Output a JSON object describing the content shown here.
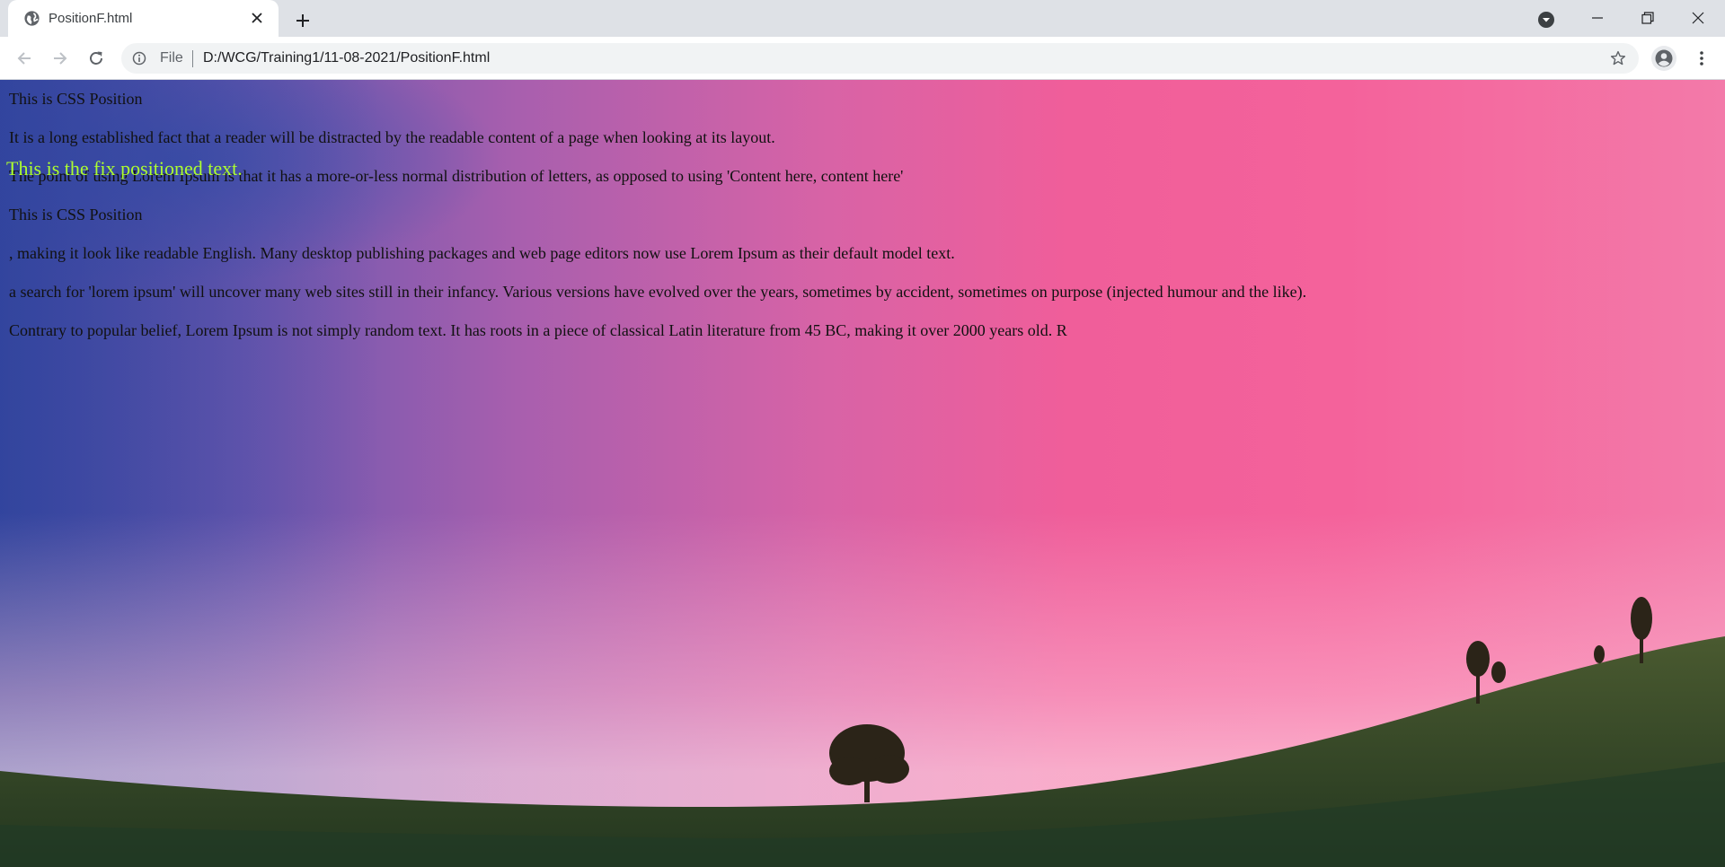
{
  "browser": {
    "tab": {
      "title": "PositionF.html",
      "favicon": "globe-icon"
    },
    "omnibox": {
      "scheme": "File",
      "url": "D:/WCG/Training1/11-08-2021/PositionF.html"
    },
    "icons": {
      "back": "arrow-left-icon",
      "forward": "arrow-right-icon",
      "reload": "reload-icon",
      "info": "info-icon",
      "star": "star-icon",
      "profile": "profile-icon",
      "menu": "kebab-menu-icon",
      "new_tab": "plus-icon",
      "tab_search": "tab-search-icon"
    }
  },
  "page": {
    "fixed_text": "This is the fix positioned text.",
    "paragraphs": [
      "This is CSS Position",
      "It is a long established fact that a reader will be distracted by the readable content of a page when looking at its layout.",
      "The point of using Lorem Ipsum is that it has a more-or-less normal distribution of letters, as opposed to using 'Content here, content here'",
      "This is CSS Position",
      ", making it look like readable English. Many desktop publishing packages and web page editors now use Lorem Ipsum as their default model text.",
      "a search for 'lorem ipsum' will uncover many web sites still in their infancy. Various versions have evolved over the years, sometimes by accident, sometimes on purpose (injected humour and the like).",
      "Contrary to popular belief, Lorem Ipsum is not simply random text. It has roots in a piece of classical Latin literature from 45 BC, making it over 2000 years old. R"
    ],
    "colors": {
      "fixed_text": "#adff2f",
      "body_text": "#111111"
    }
  }
}
